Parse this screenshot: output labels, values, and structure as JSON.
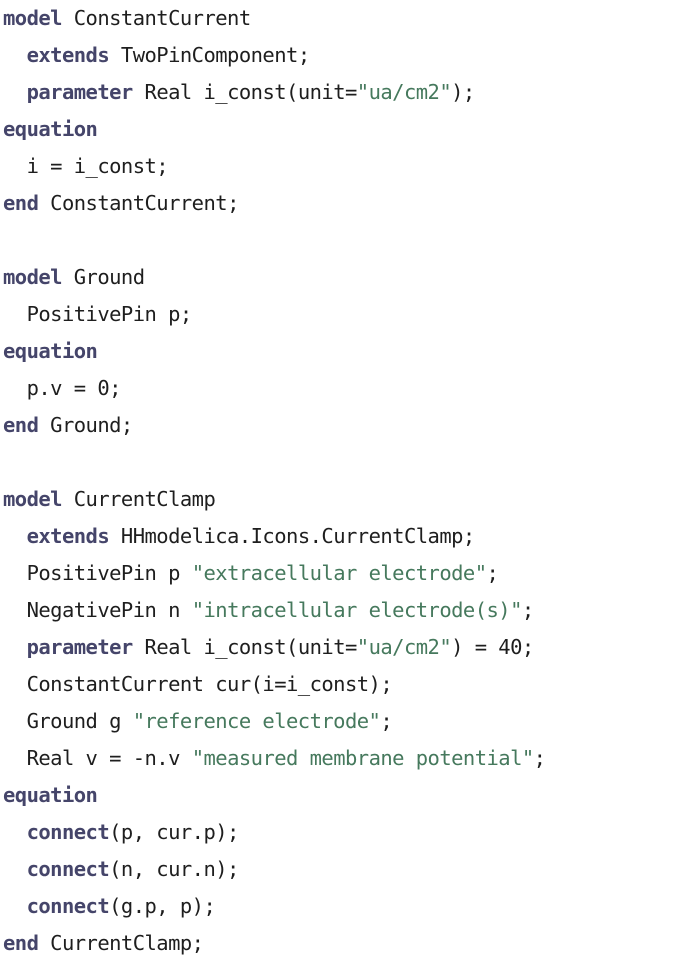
{
  "document": {
    "kind": "modelica-source-code-listing",
    "language": "Modelica",
    "colors": {
      "background": "#ffffff",
      "plain_text": "#1e1e1e",
      "keyword": "#45456a",
      "string": "#46795d"
    }
  },
  "code": {
    "lines": [
      {
        "index": 1,
        "text": "model ConstantCurrent",
        "tokens": [
          {
            "t": "kw",
            "v": "model"
          },
          {
            "t": "plain",
            "v": " ConstantCurrent"
          }
        ]
      },
      {
        "index": 2,
        "text": "  extends TwoPinComponent;",
        "tokens": [
          {
            "t": "plain",
            "v": "  "
          },
          {
            "t": "kw",
            "v": "extends"
          },
          {
            "t": "plain",
            "v": " TwoPinComponent;"
          }
        ]
      },
      {
        "index": 3,
        "text": "  parameter Real i_const(unit=\"ua/cm2\");",
        "tokens": [
          {
            "t": "plain",
            "v": "  "
          },
          {
            "t": "kw",
            "v": "parameter"
          },
          {
            "t": "plain",
            "v": " Real i_const(unit="
          },
          {
            "t": "str",
            "v": "\"ua/cm2\""
          },
          {
            "t": "plain",
            "v": ");"
          }
        ]
      },
      {
        "index": 4,
        "text": "equation",
        "tokens": [
          {
            "t": "kw",
            "v": "equation"
          }
        ]
      },
      {
        "index": 5,
        "text": "  i = i_const;",
        "tokens": [
          {
            "t": "plain",
            "v": "  i = i_const;"
          }
        ]
      },
      {
        "index": 6,
        "text": "end ConstantCurrent;",
        "tokens": [
          {
            "t": "kw",
            "v": "end"
          },
          {
            "t": "plain",
            "v": " ConstantCurrent;"
          }
        ]
      },
      {
        "index": 7,
        "text": "",
        "tokens": []
      },
      {
        "index": 8,
        "text": "model Ground",
        "tokens": [
          {
            "t": "kw",
            "v": "model"
          },
          {
            "t": "plain",
            "v": " Ground"
          }
        ]
      },
      {
        "index": 9,
        "text": "  PositivePin p;",
        "tokens": [
          {
            "t": "plain",
            "v": "  PositivePin p;"
          }
        ]
      },
      {
        "index": 10,
        "text": "equation",
        "tokens": [
          {
            "t": "kw",
            "v": "equation"
          }
        ]
      },
      {
        "index": 11,
        "text": "  p.v = 0;",
        "tokens": [
          {
            "t": "plain",
            "v": "  p.v = 0;"
          }
        ]
      },
      {
        "index": 12,
        "text": "end Ground;",
        "tokens": [
          {
            "t": "kw",
            "v": "end"
          },
          {
            "t": "plain",
            "v": " Ground;"
          }
        ]
      },
      {
        "index": 13,
        "text": "",
        "tokens": []
      },
      {
        "index": 14,
        "text": "model CurrentClamp",
        "tokens": [
          {
            "t": "kw",
            "v": "model"
          },
          {
            "t": "plain",
            "v": " CurrentClamp"
          }
        ]
      },
      {
        "index": 15,
        "text": "  extends HHmodelica.Icons.CurrentClamp;",
        "tokens": [
          {
            "t": "plain",
            "v": "  "
          },
          {
            "t": "kw",
            "v": "extends"
          },
          {
            "t": "plain",
            "v": " HHmodelica.Icons.CurrentClamp;"
          }
        ]
      },
      {
        "index": 16,
        "text": "  PositivePin p \"extracellular electrode\";",
        "tokens": [
          {
            "t": "plain",
            "v": "  PositivePin p "
          },
          {
            "t": "str",
            "v": "\"extracellular electrode\""
          },
          {
            "t": "plain",
            "v": ";"
          }
        ]
      },
      {
        "index": 17,
        "text": "  NegativePin n \"intracellular electrode(s)\";",
        "tokens": [
          {
            "t": "plain",
            "v": "  NegativePin n "
          },
          {
            "t": "str",
            "v": "\"intracellular electrode(s)\""
          },
          {
            "t": "plain",
            "v": ";"
          }
        ]
      },
      {
        "index": 18,
        "text": "  parameter Real i_const(unit=\"ua/cm2\") = 40;",
        "tokens": [
          {
            "t": "plain",
            "v": "  "
          },
          {
            "t": "kw",
            "v": "parameter"
          },
          {
            "t": "plain",
            "v": " Real i_const(unit="
          },
          {
            "t": "str",
            "v": "\"ua/cm2\""
          },
          {
            "t": "plain",
            "v": ") = 40;"
          }
        ]
      },
      {
        "index": 19,
        "text": "  ConstantCurrent cur(i=i_const);",
        "tokens": [
          {
            "t": "plain",
            "v": "  ConstantCurrent cur(i=i_const);"
          }
        ]
      },
      {
        "index": 20,
        "text": "  Ground g \"reference electrode\";",
        "tokens": [
          {
            "t": "plain",
            "v": "  Ground g "
          },
          {
            "t": "str",
            "v": "\"reference electrode\""
          },
          {
            "t": "plain",
            "v": ";"
          }
        ]
      },
      {
        "index": 21,
        "text": "  Real v = -n.v \"measured membrane potential\";",
        "tokens": [
          {
            "t": "plain",
            "v": "  Real v = -n.v "
          },
          {
            "t": "str",
            "v": "\"measured membrane potential\""
          },
          {
            "t": "plain",
            "v": ";"
          }
        ]
      },
      {
        "index": 22,
        "text": "equation",
        "tokens": [
          {
            "t": "kw",
            "v": "equation"
          }
        ]
      },
      {
        "index": 23,
        "text": "  connect(p, cur.p);",
        "tokens": [
          {
            "t": "plain",
            "v": "  "
          },
          {
            "t": "kw",
            "v": "connect"
          },
          {
            "t": "plain",
            "v": "(p, cur.p);"
          }
        ]
      },
      {
        "index": 24,
        "text": "  connect(n, cur.n);",
        "tokens": [
          {
            "t": "plain",
            "v": "  "
          },
          {
            "t": "kw",
            "v": "connect"
          },
          {
            "t": "plain",
            "v": "(n, cur.n);"
          }
        ]
      },
      {
        "index": 25,
        "text": "  connect(g.p, p);",
        "tokens": [
          {
            "t": "plain",
            "v": "  "
          },
          {
            "t": "kw",
            "v": "connect"
          },
          {
            "t": "plain",
            "v": "(g.p, p);"
          }
        ]
      },
      {
        "index": 26,
        "text": "end CurrentClamp;",
        "tokens": [
          {
            "t": "kw",
            "v": "end"
          },
          {
            "t": "plain",
            "v": " CurrentClamp;"
          }
        ]
      }
    ]
  }
}
